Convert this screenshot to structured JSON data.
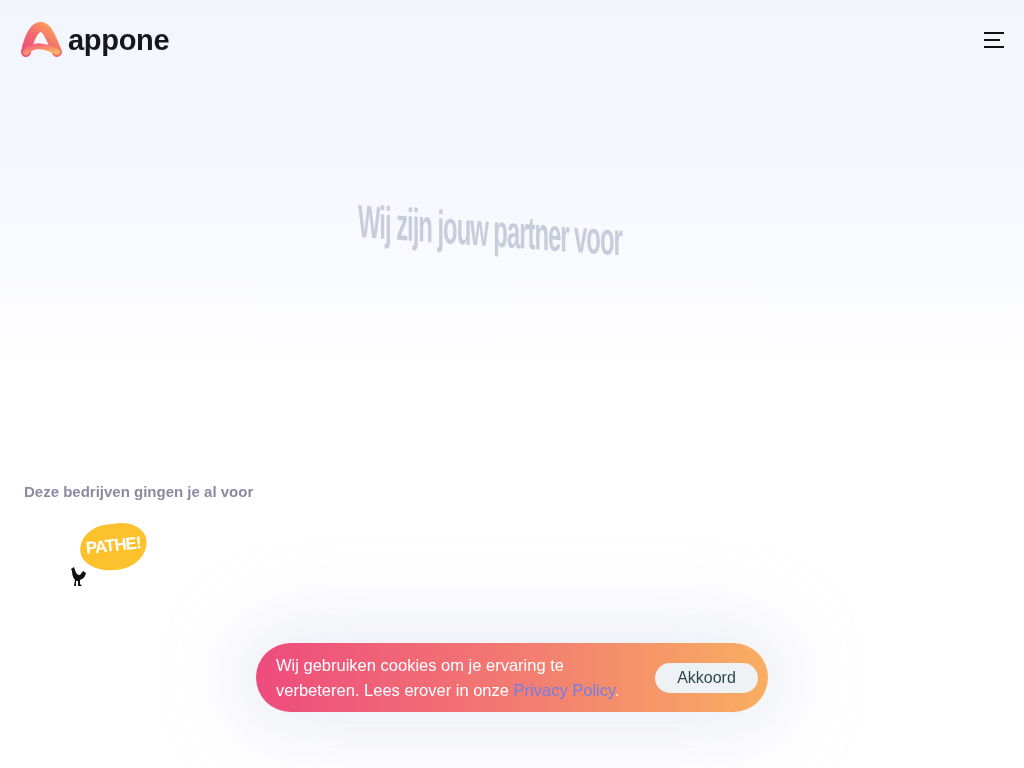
{
  "header": {
    "logo": {
      "wordmark": "appone"
    }
  },
  "hero": {
    "headline": "Wij zijn jouw partner voor"
  },
  "clients": {
    "heading": "Deze bedrijven gingen je al voor",
    "logos": [
      {
        "text": "PATHE!"
      }
    ]
  },
  "cookie_banner": {
    "message": "Wij gebruiken cookies om je ervaring te verbeteren. Lees erover in onze",
    "link": "Privacy Policy",
    "end": ".",
    "button": "Akkoord"
  }
}
